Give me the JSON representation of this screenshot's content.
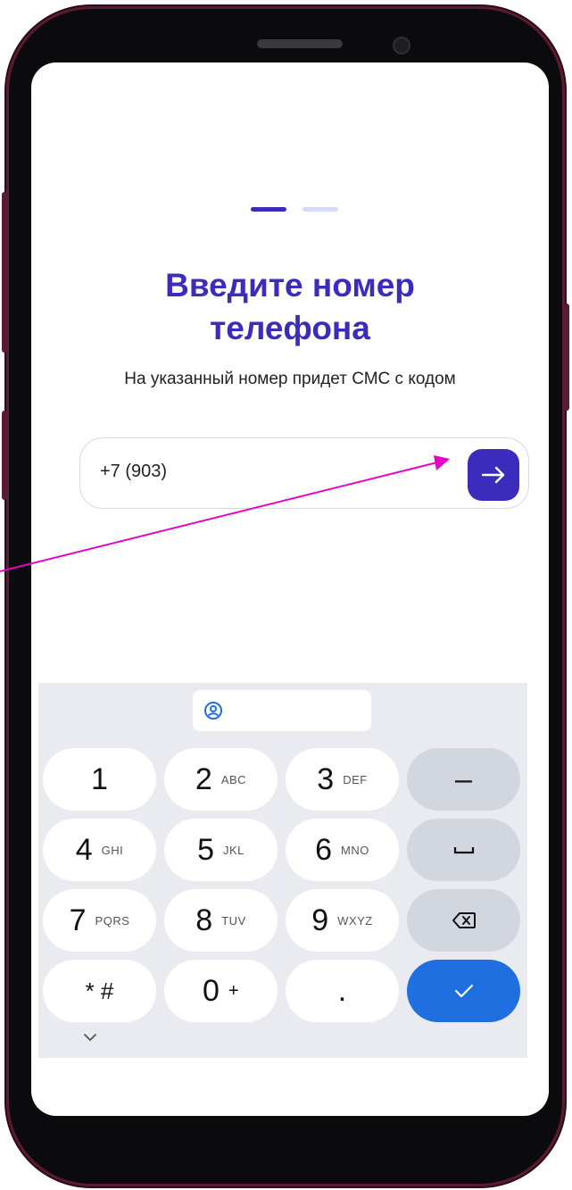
{
  "onboarding": {
    "step_total": 2,
    "step_current": 1,
    "title_line1": "Введите номер",
    "title_line2": "телефона",
    "subtitle": "На указанный номер придет СМС с кодом",
    "phone_value": "+7 (903)",
    "next_icon": "arrow-right-icon"
  },
  "keyboard": {
    "keys": [
      {
        "main": "1",
        "sub": ""
      },
      {
        "main": "2",
        "sub": "ABC"
      },
      {
        "main": "3",
        "sub": "DEF"
      },
      {
        "main": "–",
        "sub": ""
      },
      {
        "main": "4",
        "sub": "GHI"
      },
      {
        "main": "5",
        "sub": "JKL"
      },
      {
        "main": "6",
        "sub": "MNO"
      },
      {
        "main": "7",
        "sub": "PQRS"
      },
      {
        "main": "8",
        "sub": "TUV"
      },
      {
        "main": "9",
        "sub": "WXYZ"
      },
      {
        "main": "* #",
        "sub": ""
      },
      {
        "main": "0",
        "sub": "+"
      },
      {
        "main": ".",
        "sub": ""
      }
    ],
    "icons": [
      "contact-icon",
      "space-icon",
      "backspace-icon",
      "done-check-icon",
      "chevron-down-icon"
    ]
  },
  "colors": {
    "accent": "#3b2cbd",
    "accent_light": "#d5dbf7",
    "keyboard_bg": "#e9ebf0",
    "done_key": "#1f6fe0",
    "frame": "#5a1a33",
    "annotation_arrow": "#e600c8"
  }
}
